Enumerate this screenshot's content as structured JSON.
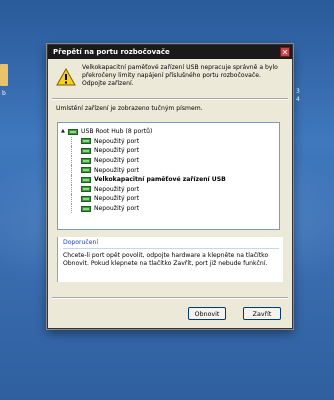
{
  "desktop": {
    "left_caption": "b",
    "right_caption_1": "3",
    "right_caption_2": "4"
  },
  "dialog": {
    "title": "Přepětí na portu rozbočovače",
    "close_glyph": "✕",
    "message": "Velkokapacitní paměťové zařízení USB nepracuje správně a bylo překročeny limity napájení příslušného portu rozbočovače. Odpojte zařízení.",
    "location_note": "Umístění zařízení je zobrazeno tučným písmem.",
    "tree": {
      "root_label": "USB Root Hub (8 portů)",
      "expander": "▲",
      "children": [
        {
          "label": "Nepoužitý port"
        },
        {
          "label": "Nepoužitý port"
        },
        {
          "label": "Nepoužitý port"
        },
        {
          "label": "Nepoužitý port"
        },
        {
          "label": "Velkokapacitní paměťové zařízení USB"
        },
        {
          "label": "Nepoužitý port"
        },
        {
          "label": "Nepoužitý port"
        },
        {
          "label": "Nepoužitý port"
        }
      ]
    },
    "info": {
      "title": "Doporučení",
      "text": "Chcete-li port opět povolit, odpojte hardware a klepněte na tlačítko Obnovit. Pokud klepnete na tlačítko Zavřít, port již nebude funkční."
    },
    "buttons": {
      "refresh_label": "Obnovit",
      "close_label": "Zavřít"
    }
  }
}
